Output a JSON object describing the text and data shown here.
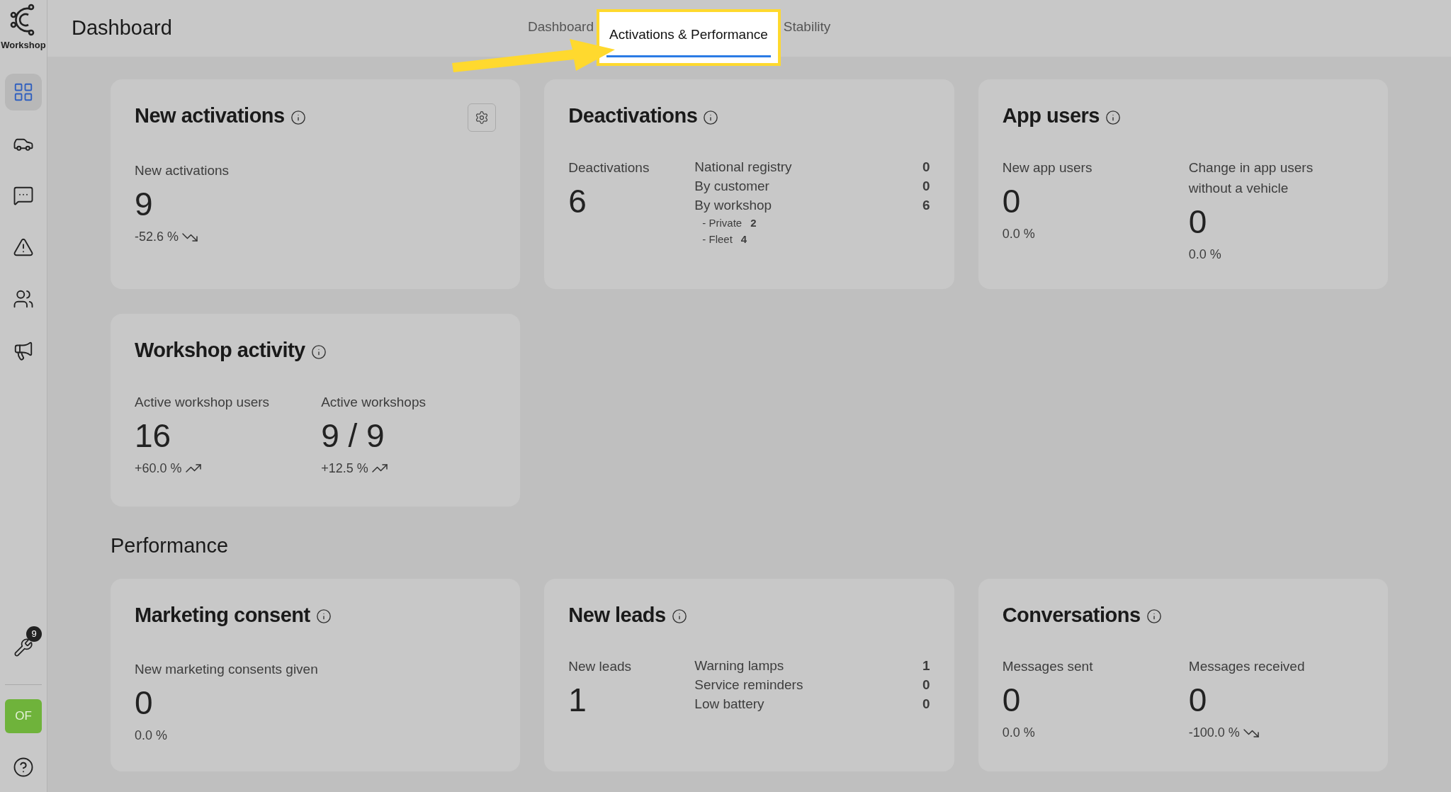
{
  "sidebar": {
    "logo_label": "Workshop",
    "nav": [
      {
        "kind": "grid",
        "selected": true
      },
      {
        "kind": "car",
        "selected": false
      },
      {
        "kind": "chat",
        "selected": false
      },
      {
        "kind": "warning",
        "selected": false
      },
      {
        "kind": "users",
        "selected": false
      },
      {
        "kind": "megaphone",
        "selected": false
      }
    ],
    "tools_badge": "9",
    "avatar": "OF"
  },
  "header": {
    "title": "Dashboard",
    "tabs": [
      {
        "label": "Dashboard",
        "selected": false,
        "highlighted": false
      },
      {
        "label": "Activations & Performance",
        "selected": true,
        "highlighted": true
      },
      {
        "label": "Stability",
        "selected": false,
        "highlighted": false
      }
    ]
  },
  "sections": [
    {
      "cards": [
        {
          "kind": "single",
          "title": "New activations",
          "settings": true,
          "metric": {
            "label": "New activations",
            "value": "9",
            "change": "-52.6 %",
            "falling": true
          }
        },
        {
          "kind": "breakdown",
          "title": "Deactivations",
          "metric": {
            "label": "Deactivations",
            "value": "6"
          },
          "rows": [
            {
              "label": "National registry",
              "value": "0"
            },
            {
              "label": "By customer",
              "value": "0"
            },
            {
              "label": "By workshop",
              "value": "6",
              "children": [
                {
                  "label": "- Private",
                  "value": "2"
                },
                {
                  "label": "- Fleet",
                  "value": "4"
                }
              ]
            }
          ]
        },
        {
          "kind": "pair",
          "title": "App users",
          "metrics": [
            {
              "label": "New app users",
              "value": "0",
              "change": "0.0 %"
            },
            {
              "label": "Change in app users without a vehicle",
              "value": "0",
              "change": "0.0 %"
            }
          ]
        },
        {
          "kind": "pair",
          "title": "Workshop activity",
          "metrics": [
            {
              "label": "Active workshop users",
              "value": "16",
              "change": "+60.0 %",
              "rising": true
            },
            {
              "label": "Active workshops",
              "value": "9 / 9",
              "change": "+12.5 %",
              "rising": true
            }
          ]
        }
      ]
    },
    {
      "title": "Performance",
      "cards": [
        {
          "kind": "single",
          "title": "Marketing consent",
          "metric": {
            "label": "New marketing consents given",
            "value": "0",
            "change": "0.0 %"
          }
        },
        {
          "kind": "breakdown",
          "title": "New leads",
          "metric": {
            "label": "New leads",
            "value": "1"
          },
          "rows": [
            {
              "label": "Warning lamps",
              "value": "1"
            },
            {
              "label": "Service reminders",
              "value": "0"
            },
            {
              "label": "Low battery",
              "value": "0"
            }
          ]
        },
        {
          "kind": "pair",
          "title": "Conversations",
          "metrics": [
            {
              "label": "Messages sent",
              "value": "0",
              "change": "0.0 %"
            },
            {
              "label": "Messages received",
              "value": "0",
              "change": "-100.0 %",
              "falling": true
            }
          ]
        }
      ]
    }
  ]
}
